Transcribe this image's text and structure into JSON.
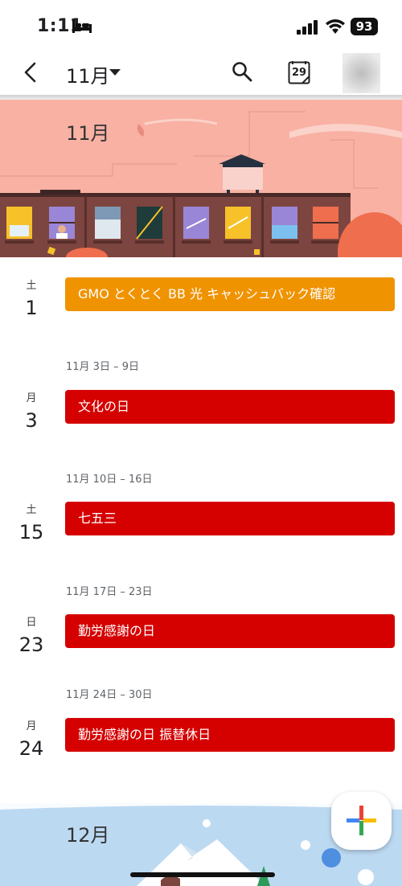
{
  "status": {
    "time": "1:11",
    "battery": "93"
  },
  "header": {
    "month_title": "11月",
    "today_number": "29"
  },
  "banner": {
    "title": "11月"
  },
  "events": [
    {
      "weekday": "土",
      "day": "1",
      "title": "GMO とくとく BB 光 キャッシュバック確認",
      "color": "#f09300"
    },
    {
      "weekday": "月",
      "day": "3",
      "title": "文化の日",
      "color": "#d50000"
    },
    {
      "weekday": "土",
      "day": "15",
      "title": "七五三",
      "color": "#d50000"
    },
    {
      "weekday": "日",
      "day": "23",
      "title": "勤労感謝の日",
      "color": "#d50000"
    },
    {
      "weekday": "月",
      "day": "24",
      "title": "勤労感謝の日 振替休日",
      "color": "#d50000"
    }
  ],
  "weeks": [
    {
      "label": "11月 3日 – 9日"
    },
    {
      "label": "11月 10日 – 16日"
    },
    {
      "label": "11月 17日 – 23日"
    },
    {
      "label": "11月 24日 – 30日"
    }
  ],
  "dec_banner": {
    "title": "12月"
  },
  "colors": {
    "accent_orange": "#f09300",
    "holiday_red": "#d50000"
  }
}
